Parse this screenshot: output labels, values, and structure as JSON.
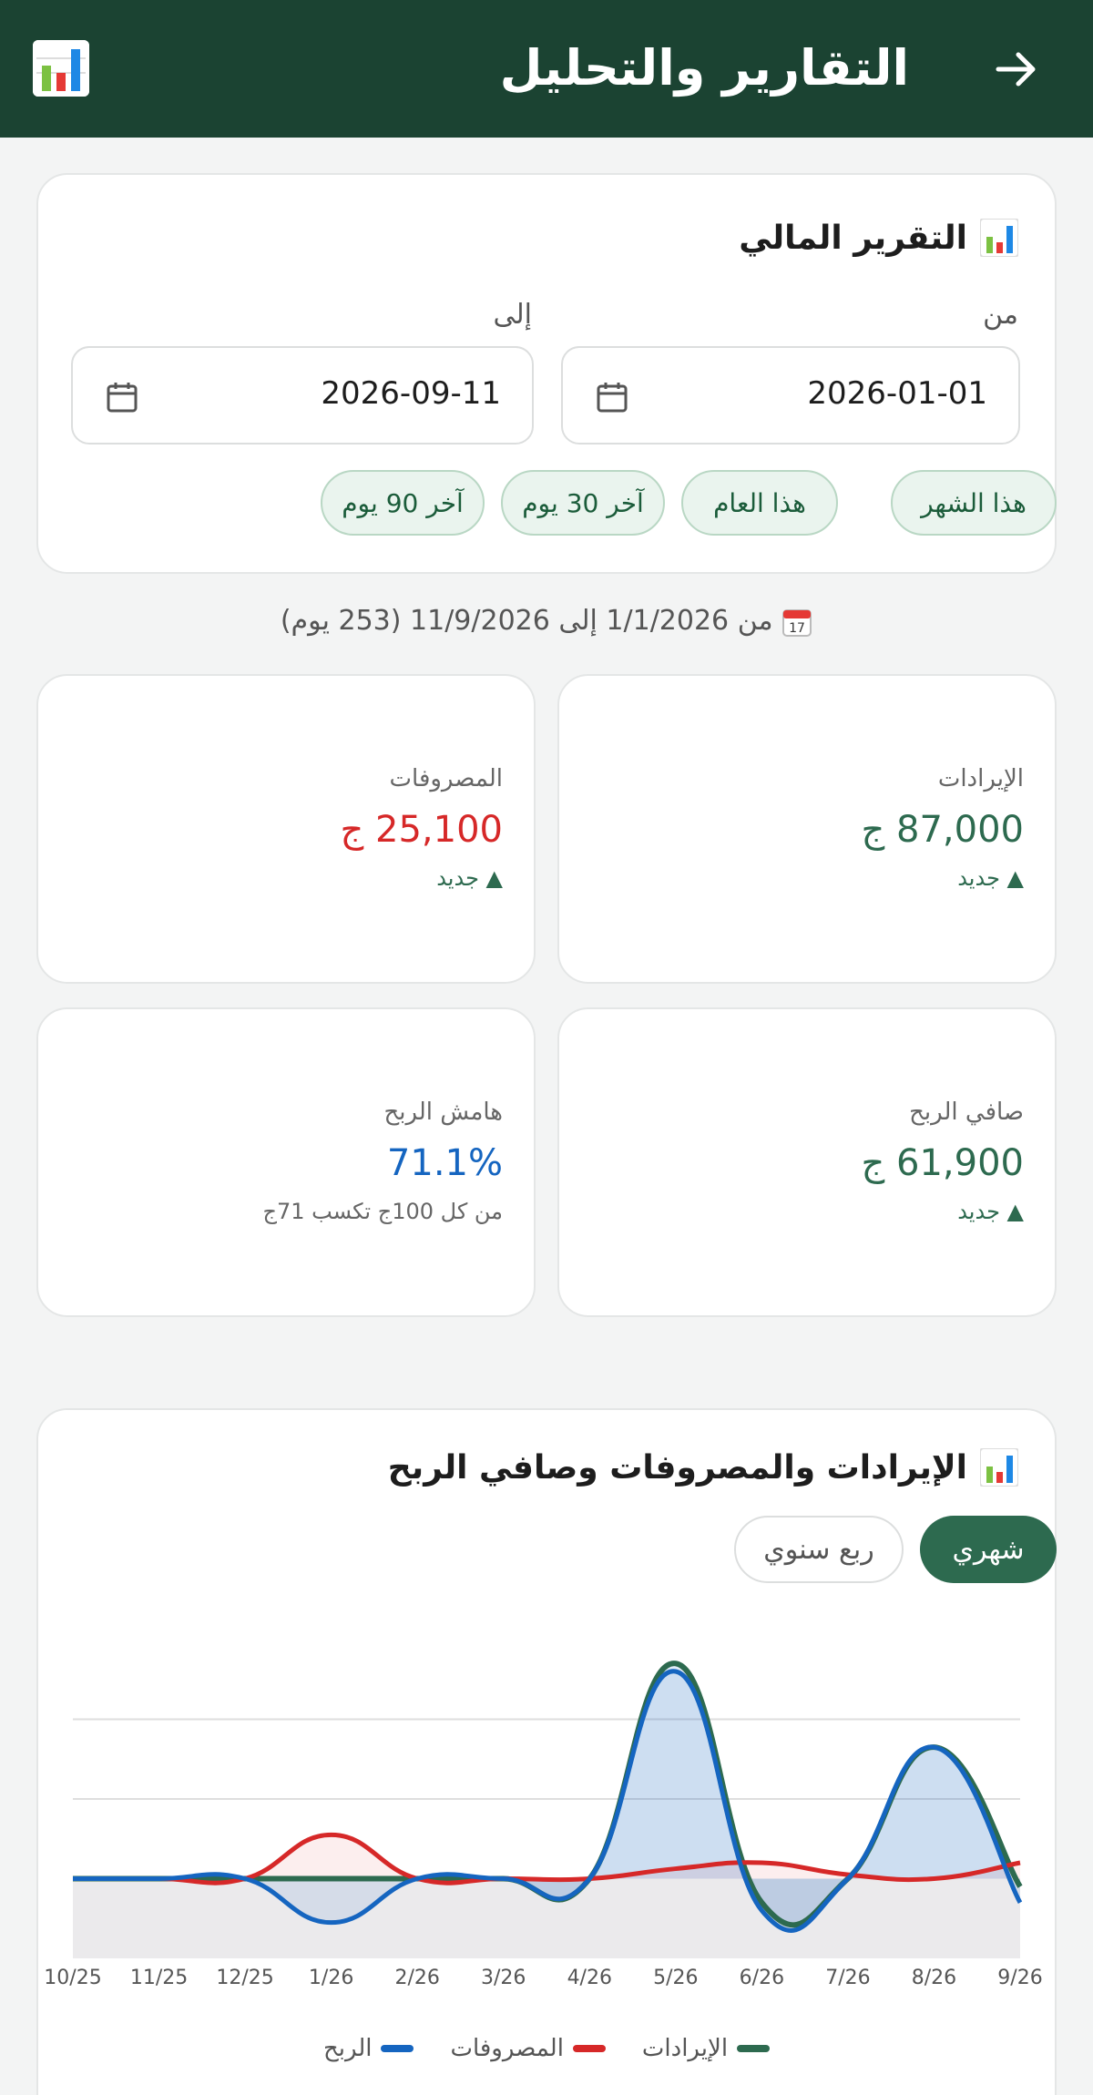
{
  "header": {
    "title": "التقارير والتحليل",
    "back_icon": "arrow-right-icon",
    "logo_icon": "bar-chart-icon"
  },
  "report": {
    "title": "التقرير المالي",
    "icon": "bar-chart-icon",
    "from_label": "من",
    "to_label": "إلى",
    "from_value": "2026-01-01",
    "to_value": "2026-09-11",
    "presets": [
      "هذا الشهر",
      "هذا العام",
      "آخر 30 يوم",
      "آخر 90 يوم"
    ]
  },
  "range_summary": {
    "icon": "calendar-icon",
    "text": "من 1/1/2026 إلى 11/9/2026   (253 يوم)"
  },
  "kpis": {
    "revenue": {
      "label": "الإيرادات",
      "value": "87,000 ج",
      "note": "▲ جديد",
      "color": "#2d6a4f"
    },
    "expenses": {
      "label": "المصروفات",
      "value": "25,100 ج",
      "note": "▲ جديد",
      "color": "#d62828"
    },
    "net_profit": {
      "label": "صافي الربح",
      "value": "61,900 ج",
      "note": "▲ جديد",
      "color": "#2d6a4f"
    },
    "margin": {
      "label": "هامش الربح",
      "value": "71.1%",
      "note": "من كل 100ج تكسب 71ج",
      "color": "#1565c0"
    }
  },
  "chart_section": {
    "title": "الإيرادات والمصروفات وصافي الربح",
    "icon": "bar-chart-icon",
    "toggle_active": "شهري",
    "toggle_inactive": "ربع سنوي"
  },
  "chart_data": {
    "type": "area",
    "categories": [
      "10/25",
      "11/25",
      "12/25",
      "1/26",
      "2/26",
      "3/26",
      "4/26",
      "5/26",
      "6/26",
      "7/26",
      "8/26",
      "9/26"
    ],
    "series": [
      {
        "name": "الإيرادات",
        "color": "#2d6a4f",
        "values": [
          0,
          0,
          0,
          0,
          0,
          0,
          0,
          54000,
          -6000,
          0,
          33000,
          -2000
        ]
      },
      {
        "name": "المصروفات",
        "color": "#d62828",
        "values": [
          0,
          0,
          0,
          11000,
          0,
          0,
          0,
          2500,
          4000,
          1000,
          0,
          4000
        ]
      },
      {
        "name": "الربح",
        "color": "#1565c0",
        "values": [
          0,
          0,
          0,
          -11000,
          0,
          0,
          0,
          52000,
          -8000,
          0,
          33000,
          -6000
        ]
      }
    ],
    "ylim": [
      -20000,
      60000
    ],
    "grid": true,
    "legend": "bottom"
  }
}
